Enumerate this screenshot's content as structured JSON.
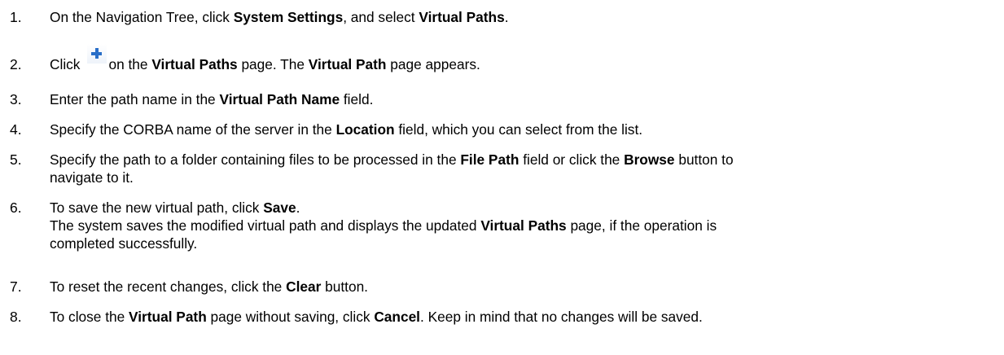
{
  "steps": [
    {
      "number": "1.",
      "parts": [
        {
          "t": "On the Navigation Tree, click "
        },
        {
          "t": "System Settings",
          "b": true
        },
        {
          "t": ", and select "
        },
        {
          "t": "Virtual Paths",
          "b": true
        },
        {
          "t": "."
        }
      ]
    },
    {
      "number": "2.",
      "parts": [
        {
          "t": "Click"
        },
        {
          "icon": "plus-icon"
        },
        {
          "t": "on the "
        },
        {
          "t": "Virtual Paths",
          "b": true
        },
        {
          "t": " page. The "
        },
        {
          "t": "Virtual Path",
          "b": true
        },
        {
          "t": " page appears."
        }
      ]
    },
    {
      "number": "3.",
      "parts": [
        {
          "t": "Enter the path name in the "
        },
        {
          "t": "Virtual Path Name",
          "b": true
        },
        {
          "t": " field."
        }
      ]
    },
    {
      "number": "4.",
      "parts": [
        {
          "t": "Specify the CORBA name of the server in the "
        },
        {
          "t": "Location",
          "b": true
        },
        {
          "t": " field, which you can select from the list."
        }
      ]
    },
    {
      "number": "5.",
      "lines": [
        [
          {
            "t": "Specify the path to a folder containing files to be processed in the "
          },
          {
            "t": "File Path",
            "b": true
          },
          {
            "t": " field or click the "
          },
          {
            "t": "Browse",
            "b": true
          },
          {
            "t": " button to"
          }
        ],
        [
          {
            "t": "navigate to it."
          }
        ]
      ]
    },
    {
      "number": "6.",
      "lines": [
        [
          {
            "t": "To save the new virtual path, click "
          },
          {
            "t": "Save",
            "b": true
          },
          {
            "t": "."
          }
        ],
        [
          {
            "t": "The system saves the modified virtual path and displays the updated "
          },
          {
            "t": "Virtual Paths",
            "b": true
          },
          {
            "t": " page, if the operation is"
          }
        ],
        [
          {
            "t": "completed successfully."
          }
        ]
      ]
    },
    {
      "number": "7.",
      "parts": [
        {
          "t": "To reset the recent changes, click the "
        },
        {
          "t": "Clear",
          "b": true
        },
        {
          "t": " button."
        }
      ]
    },
    {
      "number": "8.",
      "parts": [
        {
          "t": "To close the "
        },
        {
          "t": "Virtual Path",
          "b": true
        },
        {
          "t": " page without saving, click "
        },
        {
          "t": "Cancel",
          "b": true
        },
        {
          "t": ". Keep in mind that no changes will be saved."
        }
      ]
    }
  ]
}
